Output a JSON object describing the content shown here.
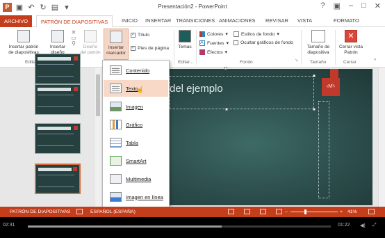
{
  "window": {
    "title": "Presentación2 - PowerPoint",
    "controls": [
      "?",
      "▣",
      "–",
      "□",
      "✕"
    ]
  },
  "tabs": [
    {
      "label": "ARCHIVO"
    },
    {
      "label": "PATRÓN DE DIAPOSITIVAS"
    },
    {
      "label": "INICIO"
    },
    {
      "label": "INSERTAR"
    },
    {
      "label": "TRANSICIONES"
    },
    {
      "label": "ANIMACIONES"
    },
    {
      "label": "REVISAR"
    },
    {
      "label": "VISTA"
    },
    {
      "label": "FORMATO"
    }
  ],
  "ribbon": {
    "insert_master": "Insertar patrón de diapositivas",
    "insert_master_l1": "Insertar patrón",
    "insert_master_l2": "de diapositivas",
    "insert_layout_l1": "Insertar",
    "insert_layout_l2": "diseño",
    "design_l1": "Diseño",
    "design_l2": "del patrón",
    "insert_placeholder_l1": "Insertar",
    "insert_placeholder_l2": "marcador",
    "chk_title": "Título",
    "chk_footer": "Pies de página",
    "themes": "Temas",
    "colors": "Colores",
    "fonts": "Fuentes",
    "effects": "Efectos",
    "bg_styles": "Estilos de fondo",
    "hide_bg": "Ocultar gráficos de fondo",
    "slide_size_l1": "Tamaño de",
    "slide_size_l2": "diapositiva",
    "close_l1": "Cerrar vista",
    "close_l2": "Patrón",
    "group_edit_master": "Editar patrón",
    "group_edit": "Editar...",
    "group_bg": "Fondo",
    "group_size": "Tamaño",
    "group_close": "Cerrar"
  },
  "dropdown": [
    {
      "label": "Contenido"
    },
    {
      "label": "Texto"
    },
    {
      "label": "Imagen"
    },
    {
      "label": "Gráfico"
    },
    {
      "label": "Tabla"
    },
    {
      "label": "SmartArt"
    },
    {
      "label": "Multimedia"
    },
    {
      "label": "Imagen en línea"
    }
  ],
  "slide": {
    "title_text": "del ejemplo",
    "number_tag": "‹Nº›"
  },
  "statusbar": {
    "view_label": "PATRÓN DE DIAPOSITIVAS",
    "language": "ESPAÑOL (ESPAÑA)",
    "zoom": "41%"
  },
  "player": {
    "elapsed": "02:31",
    "remaining": "01:22",
    "progress_fraction": 0.64
  },
  "colors": {
    "accent": "#c43e1c",
    "slide_bg": "#2a4a48",
    "hover": "#f8d9c8"
  }
}
